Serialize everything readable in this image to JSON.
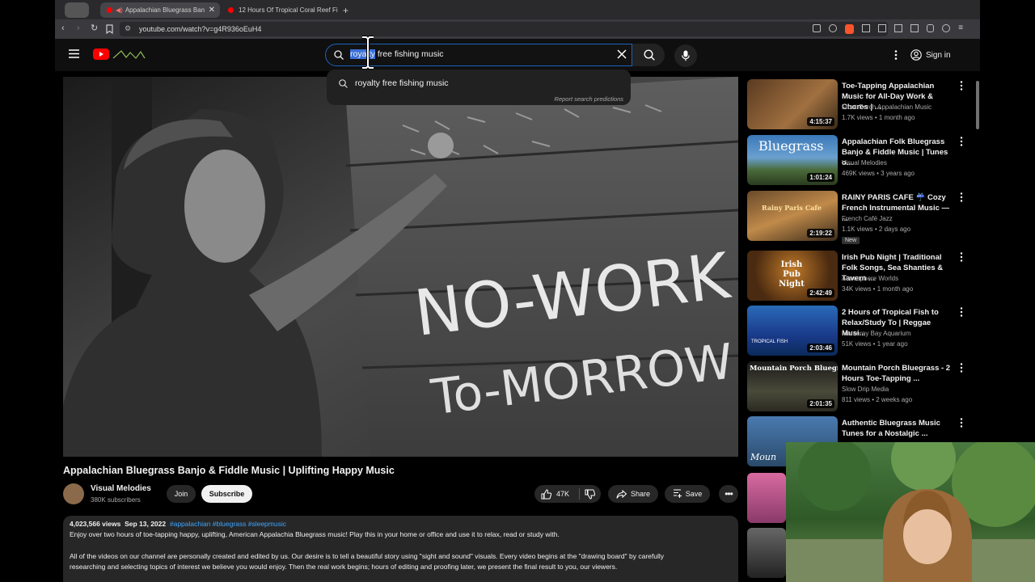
{
  "browser": {
    "tabs": [
      {
        "label": "Appalachian Bluegrass Ban",
        "active": true
      },
      {
        "label": "12 Hours Of Tropical Coral Reef Fi",
        "active": false
      }
    ],
    "url": "youtube.com/watch?v=g4R936oEuH4"
  },
  "youtube": {
    "search": {
      "query": "royalty free fishing music",
      "query_selected": "royalty",
      "query_rest": " free fishing music",
      "suggestion": "royalty free fishing music",
      "report": "Report search predictions"
    },
    "sign_in": "Sign in"
  },
  "video": {
    "overlay_line1": "NO-WORK",
    "overlay_line2": "To-MORROW",
    "title": "Appalachian Bluegrass Banjo & Fiddle Music | Uplifting Happy Music",
    "channel": "Visual Melodies",
    "subscribers": "380K subscribers",
    "join": "Join",
    "subscribe": "Subscribe",
    "likes": "47K",
    "share": "Share",
    "save": "Save",
    "views": "4,023,566 views",
    "date": "Sep 13, 2022",
    "hashtags": "#appalachian #bluegrass #sleepmusic",
    "desc1": "Enjoy over two hours of toe-tapping happy, uplifting, American Appalachia Bluegrass music! Play this in your home or office and use it to relax, read or study with.",
    "desc2": "All of the videos on our channel are personally created and edited by us. Our desire is to tell a beautiful story using \"sight and sound\" visuals. Every video begins at the \"drawing board\" by carefully",
    "desc3": "researching and selecting topics of interest we believe you would enjoy. Then the real work begins; hours of editing and proofing later, we present the final result to you, our viewers."
  },
  "related": [
    {
      "title": "Toe-Tapping Appalachian Music for All-Day Work & Chores | ...",
      "channel": "Front-Porch Appalachian Music",
      "meta": "1.7K views • 1 month ago",
      "duration": "4:15:37",
      "thumb_text": "",
      "badge": ""
    },
    {
      "title": "Appalachian Folk Bluegrass Banjo & Fiddle Music | Tunes o...",
      "channel": "Visual Melodies",
      "meta": "469K views • 3 years ago",
      "duration": "1:01:24",
      "thumb_text": "Bluegrass",
      "badge": ""
    },
    {
      "title": "RAINY PARIS CAFE ☔ Cozy French Instrumental Music — ...",
      "channel": "French Café Jazz",
      "meta": "1.1K views • 2 days ago",
      "duration": "2:19:22",
      "thumb_text": "Rainy Paris Cafe",
      "badge": "New"
    },
    {
      "title": "Irish Pub Night | Traditional Folk Songs, Sea Shanties & Tavern ...",
      "channel": "Atmosphere Worlds",
      "meta": "34K views • 1 month ago",
      "duration": "2:42:49",
      "thumb_text": "Irish Pub Night",
      "badge": ""
    },
    {
      "title": "2 Hours of Tropical Fish to Relax/Study To | Reggae Musi...",
      "channel": "Monterey Bay Aquarium",
      "meta": "51K views • 1 year ago",
      "duration": "2:03:46",
      "thumb_text": "TROPICAL FISH",
      "badge": ""
    },
    {
      "title": "Mountain Porch Bluegrass - 2 Hours Toe-Tapping ...",
      "channel": "Slow Drip Media",
      "meta": "811 views • 2 weeks ago",
      "duration": "2:01:35",
      "thumb_text": "Mountain Porch Bluegrass",
      "badge": ""
    },
    {
      "title": "Authentic Bluegrass Music Tunes for a Nostalgic ...",
      "channel": "",
      "meta": "",
      "duration": "",
      "thumb_text": "Moun",
      "badge": ""
    }
  ],
  "colors": {
    "accent": "#3ea6ff",
    "yt_red": "#ff0000",
    "search_border": "#1c62b9"
  }
}
